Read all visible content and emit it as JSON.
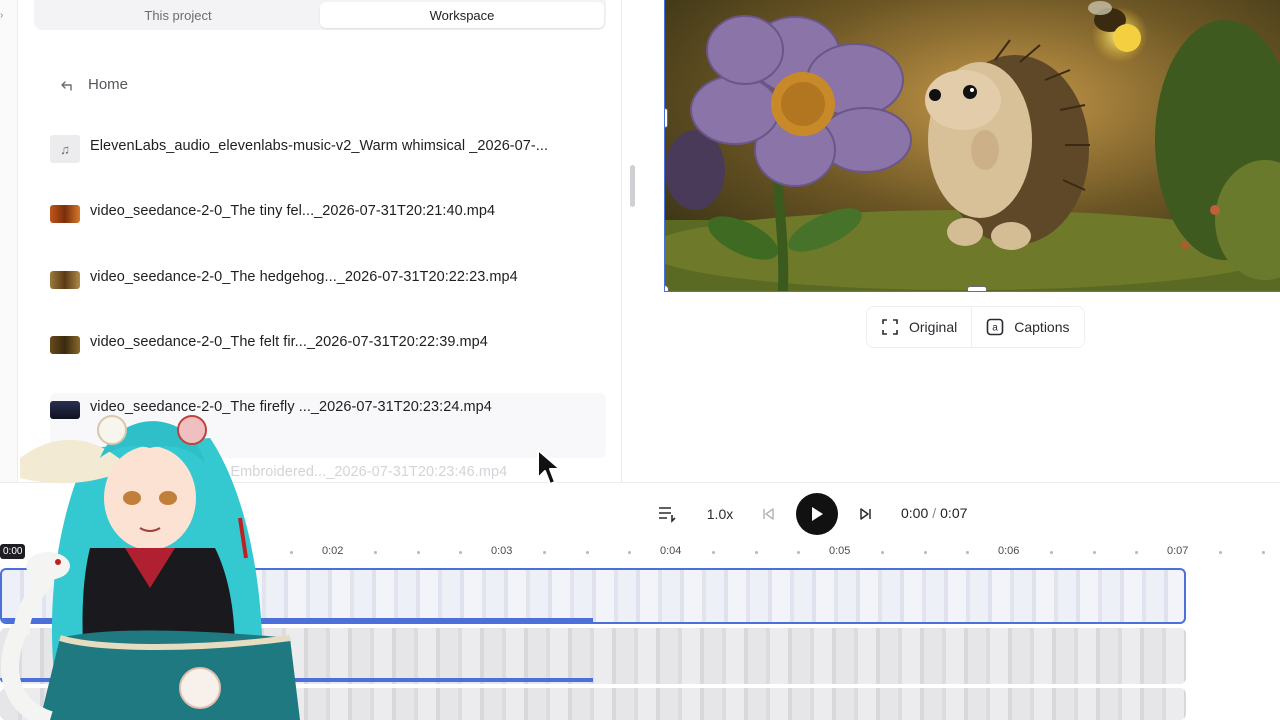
{
  "panel": {
    "tabs": [
      {
        "label": "This project",
        "active": false
      },
      {
        "label": "Workspace",
        "active": true
      }
    ],
    "home_label": "Home",
    "files": [
      {
        "name": "ElevenLabs_audio_elevenlabs-music-v2_Warm whimsical _2026-07-...",
        "kind": "audio",
        "icon": "music-note-icon"
      },
      {
        "name": "video_seedance-2-0_The tiny fel..._2026-07-31T20:21:40.mp4",
        "kind": "video",
        "thumb": "#8a3a12"
      },
      {
        "name": "video_seedance-2-0_The hedgehog..._2026-07-31T20:22:23.mp4",
        "kind": "video",
        "thumb": "#6b4a1c"
      },
      {
        "name": "video_seedance-2-0_The felt fir..._2026-07-31T20:22:39.mp4",
        "kind": "video",
        "thumb": "#4a3a1a"
      },
      {
        "name": "video_seedance-2-0_The firefly ..._2026-07-31T20:23:24.mp4",
        "kind": "video",
        "thumb": "#1c2238"
      },
      {
        "name": "video_seedance-2-0_Embroidered..._2026-07-31T20:23:46.mp4",
        "kind": "video",
        "thumb": "#5a4a2a",
        "faded": true
      }
    ]
  },
  "preview": {
    "buttons": {
      "original": "Original",
      "captions": "Captions"
    }
  },
  "playback": {
    "speed": "1.0x",
    "current": "0:00",
    "separator": "/",
    "duration": "0:07",
    "progress": 0.0
  },
  "timeline": {
    "playhead_label": "0:00",
    "labels": [
      "0:02",
      "0:03",
      "0:04",
      "0:05",
      "0:06",
      "0:07"
    ],
    "track_progress": 0.5
  },
  "colors": {
    "accent": "#4d6fd9",
    "play_button": "#111111"
  }
}
